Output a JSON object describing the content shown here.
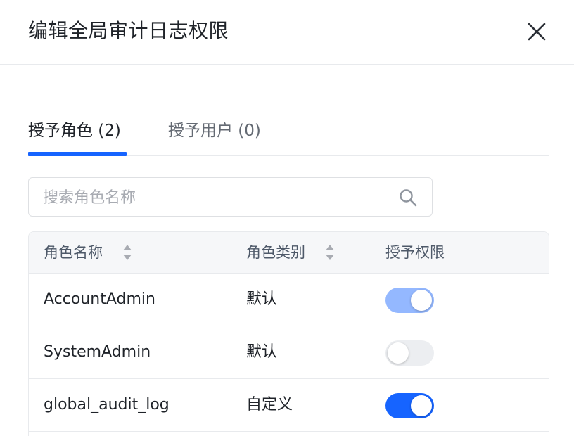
{
  "dialog": {
    "title": "编辑全局审计日志权限"
  },
  "tabs": [
    {
      "label": "授予角色 (2)",
      "active": true
    },
    {
      "label": "授予用户 (0)",
      "active": false
    }
  ],
  "search": {
    "placeholder": "搜索角色名称",
    "value": "",
    "icon": "search-icon"
  },
  "table": {
    "columns": [
      {
        "label": "角色名称",
        "sortable": true
      },
      {
        "label": "角色类别",
        "sortable": true
      },
      {
        "label": "授予权限",
        "sortable": false
      }
    ],
    "rows": [
      {
        "name": "AccountAdmin",
        "category": "默认",
        "granted": true,
        "disabled": true
      },
      {
        "name": "SystemAdmin",
        "category": "默认",
        "granted": false,
        "disabled": true
      },
      {
        "name": "global_audit_log",
        "category": "自定义",
        "granted": true,
        "disabled": false
      }
    ]
  },
  "colors": {
    "primary": "#1664ff",
    "switch_on_disabled": "#94b8ff",
    "switch_off": "#eceef1"
  }
}
